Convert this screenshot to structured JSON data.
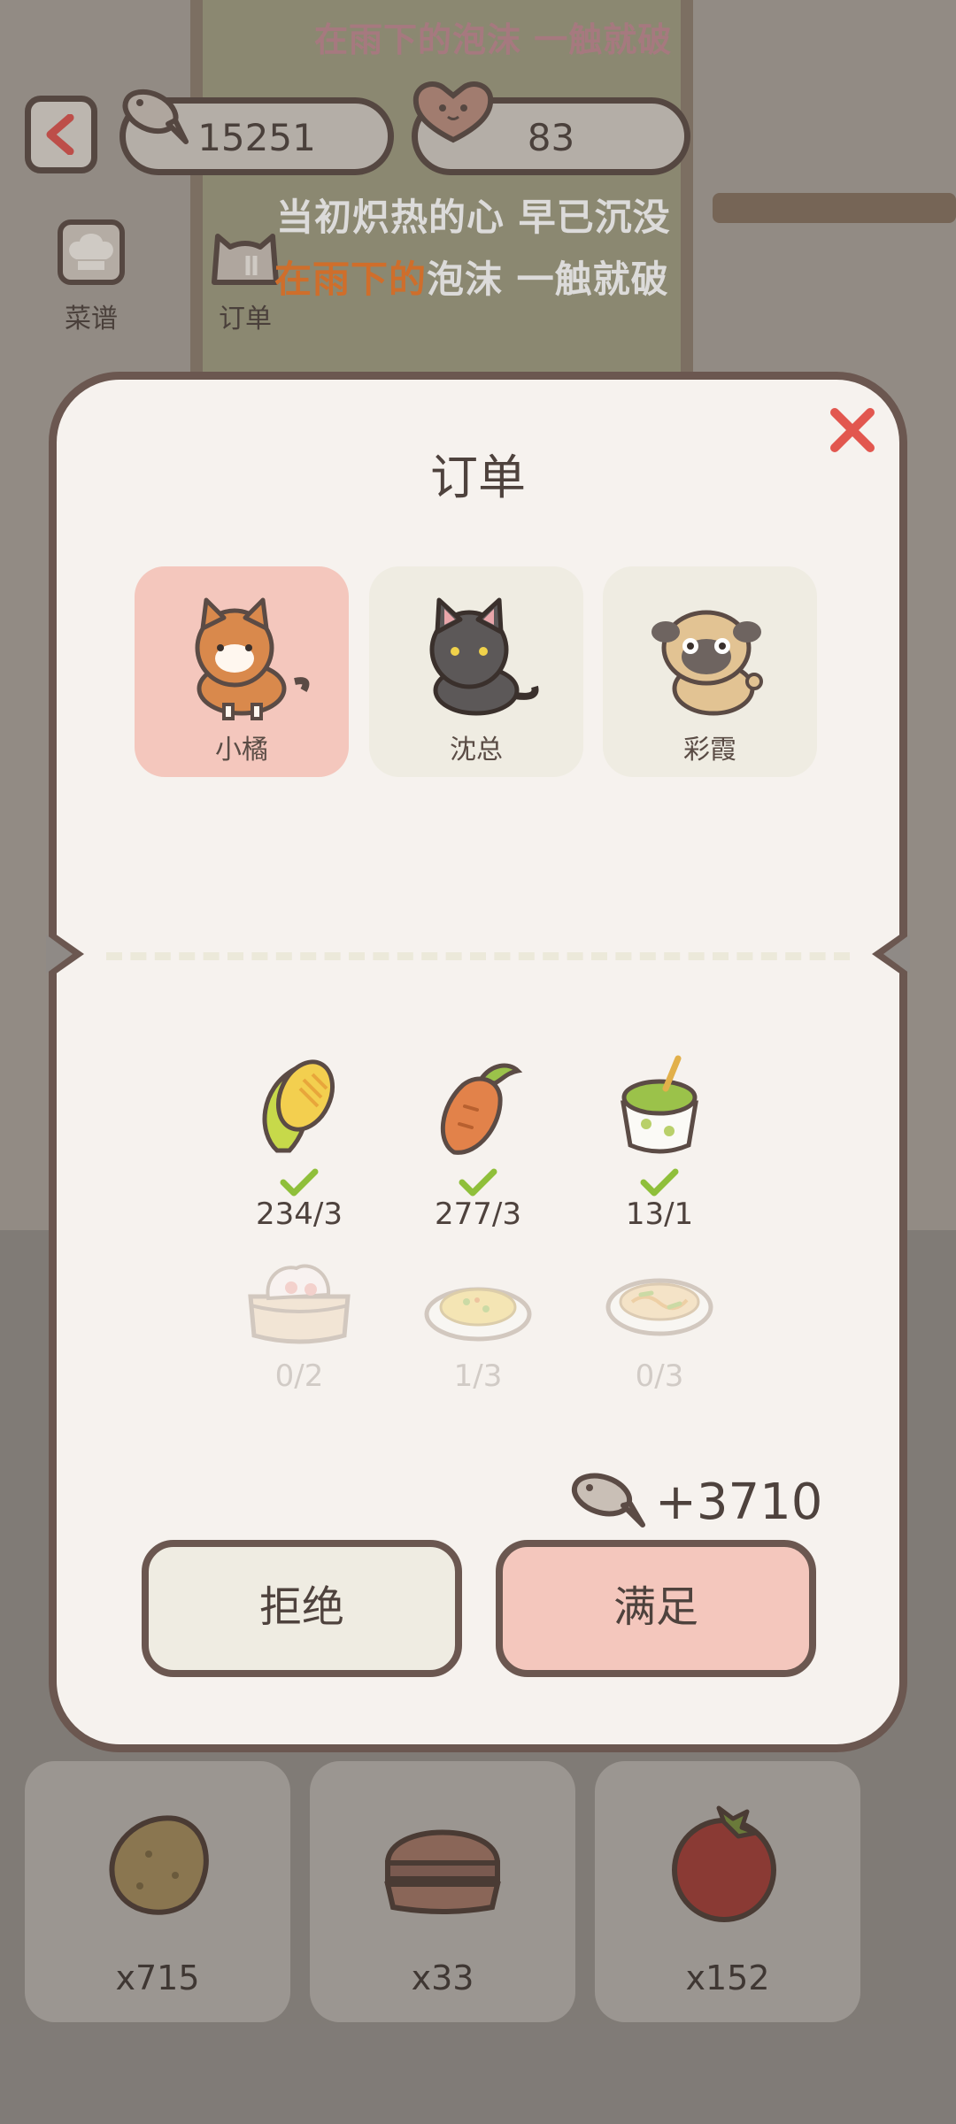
{
  "lyrics": {
    "faded_line": "在雨下的泡沫 一触就破",
    "line1": "当初炽热的心 早已沉没",
    "line2_highlight": "在雨下的",
    "line2_rest": "泡沫 一触就破"
  },
  "currency": {
    "fish": "15251",
    "hearts": "83"
  },
  "side_buttons": {
    "recipes": "菜谱",
    "orders": "订单"
  },
  "modal": {
    "title": "订单",
    "customers": [
      {
        "name": "小橘",
        "selected": true
      },
      {
        "name": "沈总",
        "selected": false
      },
      {
        "name": "彩霞",
        "selected": false
      }
    ],
    "requirements": [
      {
        "icon": "corn-icon",
        "count": "234/3",
        "met": true
      },
      {
        "icon": "carrot-icon",
        "count": "277/3",
        "met": true
      },
      {
        "icon": "matcha-dessert-icon",
        "count": "13/1",
        "met": true
      },
      {
        "icon": "dumpling-steamer-icon",
        "count": "0/2",
        "met": false
      },
      {
        "icon": "fried-rice-icon",
        "count": "1/3",
        "met": false
      },
      {
        "icon": "noodles-icon",
        "count": "0/3",
        "met": false
      }
    ],
    "reward": "+3710",
    "reject_label": "拒绝",
    "accept_label": "满足"
  },
  "inventory": [
    {
      "icon": "potato-icon",
      "qty": "x715"
    },
    {
      "icon": "bun-icon",
      "qty": "x33"
    },
    {
      "icon": "tomato-icon",
      "qty": "x152"
    }
  ],
  "colors": {
    "accent_pink": "#f4c7bd",
    "check_green": "#8fbf3a",
    "close_red": "#e2574f",
    "outline": "#6b5750"
  }
}
